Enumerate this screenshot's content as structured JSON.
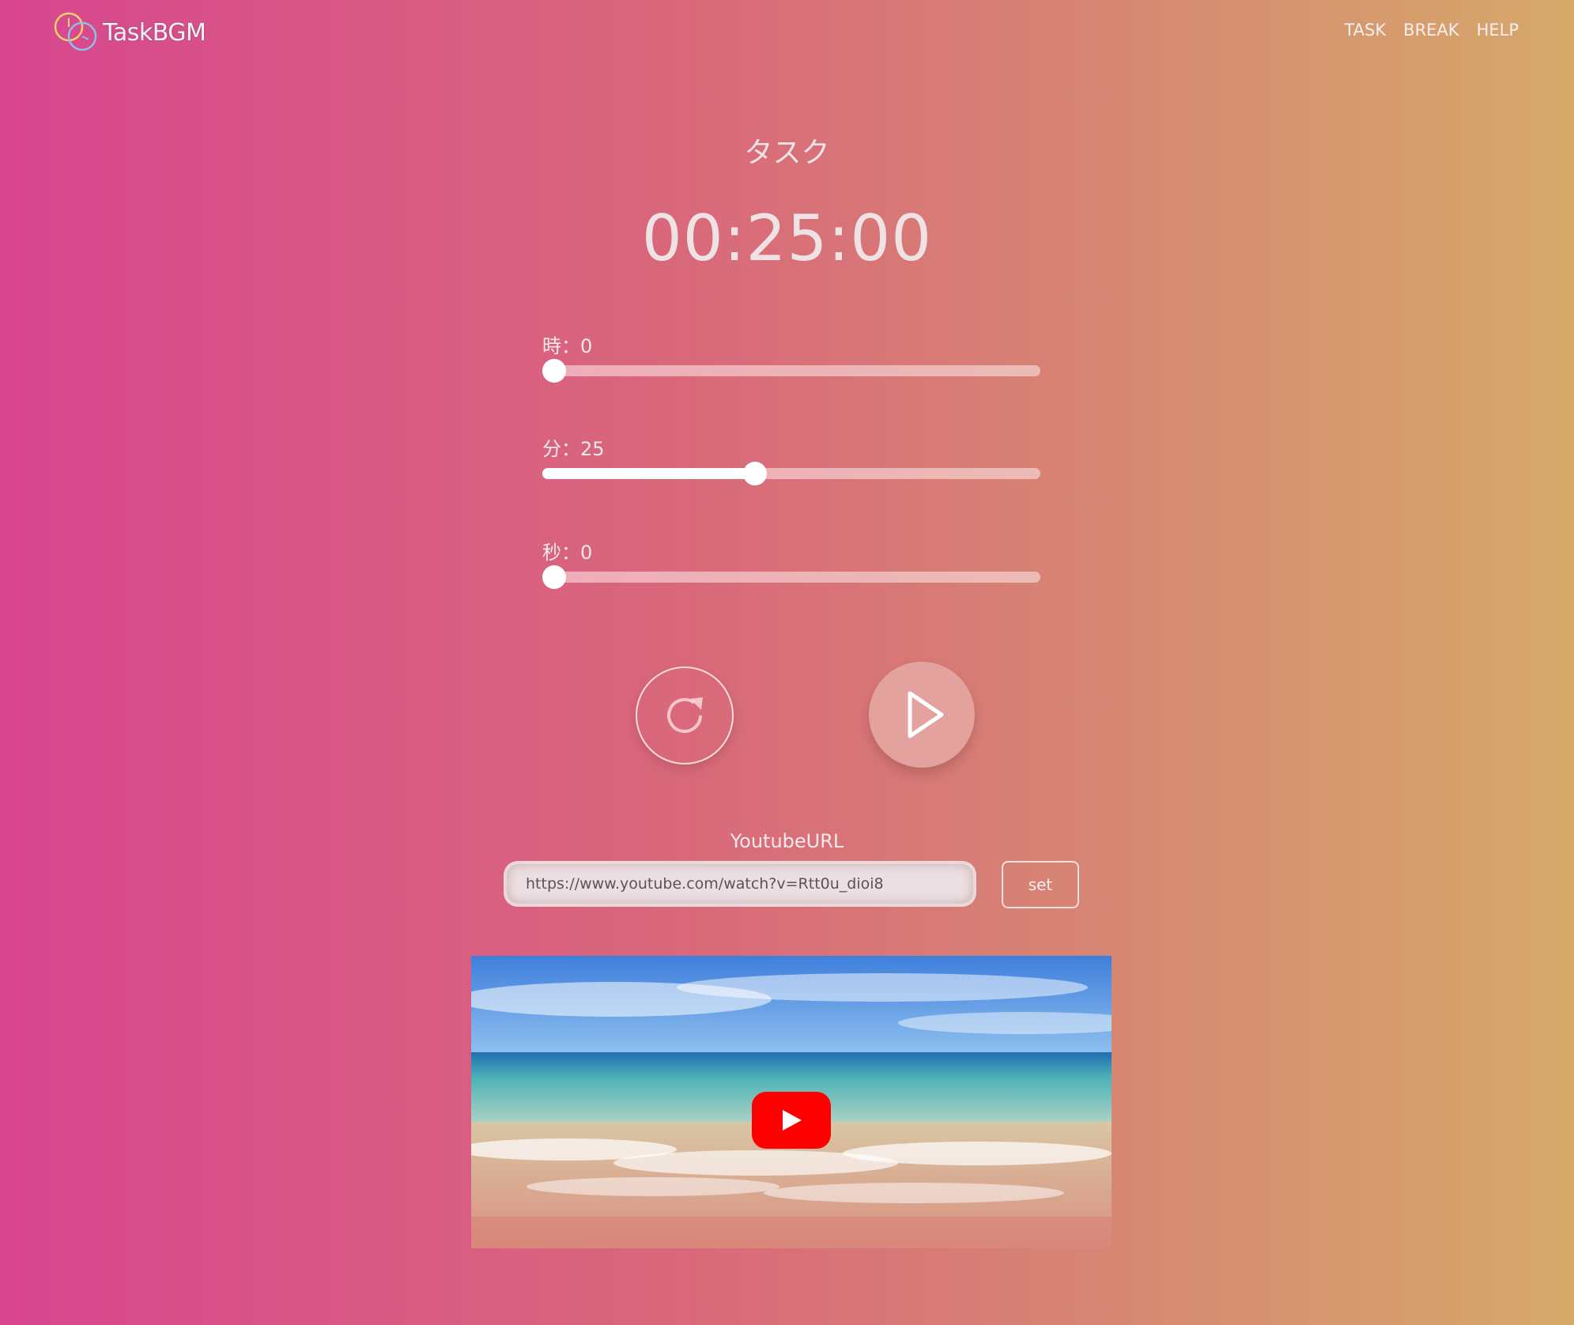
{
  "app": {
    "name": "TaskBGM"
  },
  "nav": {
    "items": [
      "TASK",
      "BREAK",
      "HELP"
    ]
  },
  "timer": {
    "mode_title": "タスク",
    "display": "00:25:00"
  },
  "sliders": {
    "hours": {
      "label": "時：0",
      "value": 0,
      "max": 23
    },
    "minutes": {
      "label": "分：25",
      "value": 25,
      "max": 59
    },
    "seconds": {
      "label": "秒：0",
      "value": 0,
      "max": 59
    }
  },
  "controls": {
    "reset_icon": "reset-icon",
    "play_icon": "play-icon"
  },
  "youtube": {
    "label": "YoutubeURL",
    "url_value": "https://www.youtube.com/watch?v=Rtt0u_dioi8",
    "set_label": "set",
    "play_button_color": "#ff0000"
  },
  "colors": {
    "accent_red": "#ff0000",
    "gradient_start": "#d8468f",
    "gradient_end": "#d6a96a"
  }
}
